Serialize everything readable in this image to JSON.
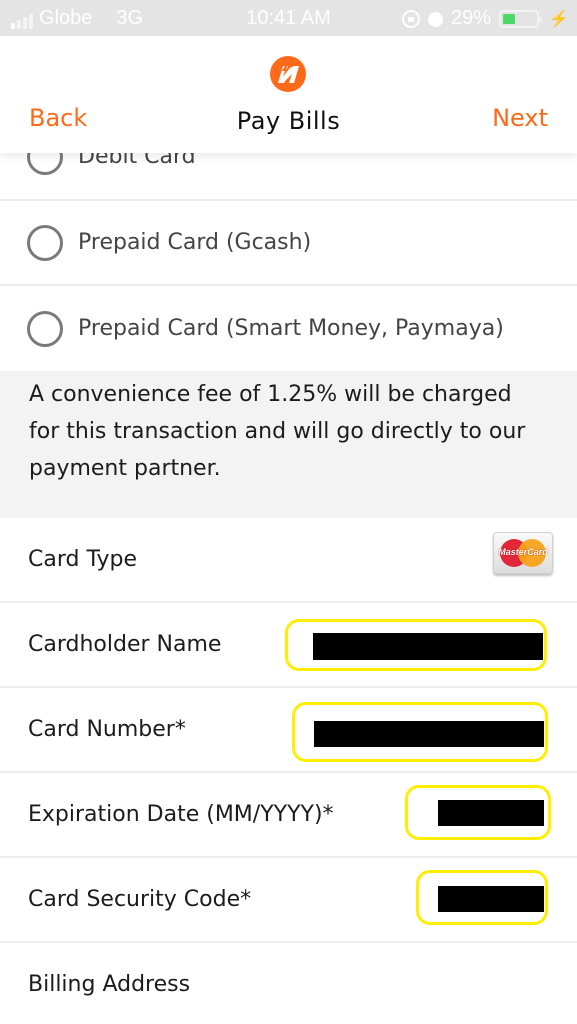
{
  "status_bar": {
    "carrier": "Globe",
    "network": "3G",
    "time": "10:41 AM",
    "battery_percent_label": "29%",
    "battery_level": 0.29,
    "icons": [
      "signal-icon",
      "rotation-lock-icon",
      "alarm-icon",
      "battery-icon",
      "charging-bolt-icon"
    ]
  },
  "header": {
    "logo": "brand-m-logo",
    "back_label": "Back",
    "title": "Pay Bills",
    "next_label": "Next",
    "accent_color": "#ff6a1a"
  },
  "payment_options": [
    {
      "label": "Debit Card",
      "selected": false
    },
    {
      "label": "Prepaid Card (Gcash)",
      "selected": false
    },
    {
      "label": "Prepaid Card (Smart Money, Paymaya)",
      "selected": false
    }
  ],
  "notice": "A convenience fee of 1.25% will be charged for this transaction and will go directly to our payment partner.",
  "form": {
    "card_type": {
      "label": "Card Type",
      "value": "MasterCard",
      "logo_text": "MasterCard"
    },
    "cardholder_name": {
      "label": "Cardholder Name",
      "value": "[redacted]"
    },
    "card_number": {
      "label": "Card Number*",
      "value": "[redacted]"
    },
    "expiration_date": {
      "label": "Expiration Date (MM/YYYY)*",
      "value": "[redacted]"
    },
    "security_code": {
      "label": "Card Security Code*",
      "value": "[redacted]"
    },
    "billing_address": {
      "label": "Billing Address",
      "value": ""
    }
  }
}
